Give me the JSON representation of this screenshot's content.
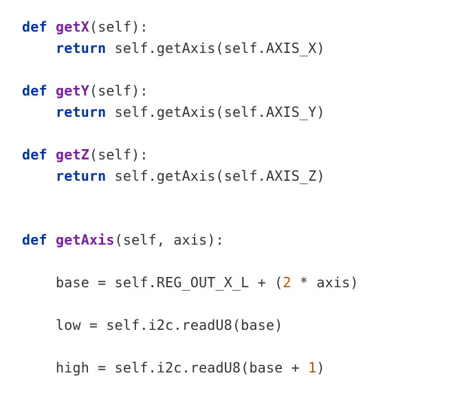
{
  "code": {
    "getX": {
      "def_kw": "def",
      "name": "getX",
      "params": "(self):",
      "ret_kw": "return",
      "body": " self.getAxis(self.AXIS_X)"
    },
    "getY": {
      "def_kw": "def",
      "name": "getY",
      "params": "(self):",
      "ret_kw": "return",
      "body": " self.getAxis(self.AXIS_Y)"
    },
    "getZ": {
      "def_kw": "def",
      "name": "getZ",
      "params": "(self):",
      "ret_kw": "return",
      "body": " self.getAxis(self.AXIS_Z)"
    },
    "getAxis": {
      "def_kw": "def",
      "name": "getAxis",
      "params": "(self, axis):",
      "base_lhs": "base = self.REG_OUT_X_L + (",
      "base_num": "2",
      "base_rhs": " * axis)",
      "low_line": "low = self.i2c.readU8(base)",
      "high_lhs": "high = self.i2c.readU8(base + ",
      "high_num": "1",
      "high_rhs": ")"
    }
  }
}
